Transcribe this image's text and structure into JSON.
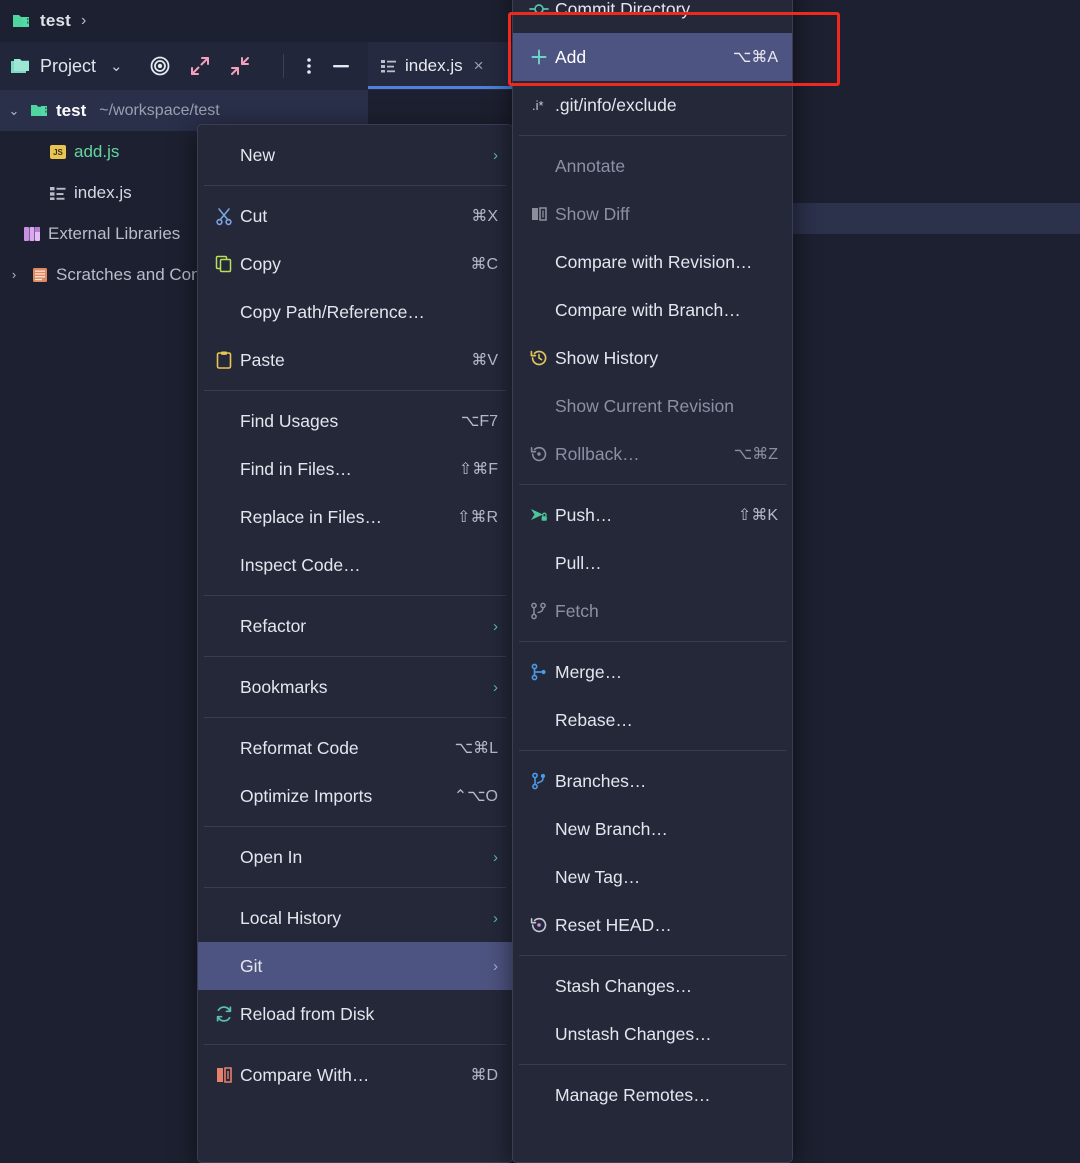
{
  "app": {
    "theme_bg": "#1d2030",
    "menu_bg": "#242839",
    "highlight_color": "#4e5481",
    "annotation_color": "#ee2a1e",
    "accent_blue": "#4d82d8"
  },
  "breadcrumb": {
    "project": "test",
    "separator": "›",
    "icon": "project-folder-icon"
  },
  "tool_window": {
    "title": "Project",
    "chevron": "⌄",
    "icons": [
      {
        "name": "select-opened-file-icon",
        "title": "Select Opened File"
      },
      {
        "name": "expand-all-icon",
        "title": "Expand All"
      },
      {
        "name": "collapse-all-icon",
        "title": "Collapse All"
      },
      {
        "name": "more-options-icon",
        "title": "Options"
      },
      {
        "name": "hide-icon",
        "title": "Hide"
      }
    ]
  },
  "editor_tab": {
    "label": "index.js",
    "icon": "js-file-icon",
    "close": "×"
  },
  "project_tree": [
    {
      "label": "test",
      "path": "~/workspace/test",
      "arrow": "⌄",
      "icon": "module-folder-icon",
      "color": "#ffffff",
      "bold": true,
      "selected": true,
      "indent": 0
    },
    {
      "label": "add.js",
      "path": "",
      "arrow": "",
      "icon": "js-badge-icon",
      "color": "#63d6a0",
      "bold": false,
      "selected": false,
      "indent": 1
    },
    {
      "label": "index.js",
      "path": "",
      "arrow": "",
      "icon": "js-plain-icon",
      "color": "#d6d9e3",
      "bold": false,
      "selected": false,
      "indent": 1
    },
    {
      "label": "External Libraries",
      "path": "",
      "arrow": "",
      "icon": "library-icon",
      "color": "#b9bdca",
      "bold": false,
      "selected": false,
      "indent": 0
    },
    {
      "label": "Scratches and Consoles",
      "path": "",
      "arrow": "›",
      "icon": "scratches-icon",
      "color": "#b9bdca",
      "bold": false,
      "selected": false,
      "indent": 0
    }
  ],
  "context_menu": {
    "items": [
      {
        "type": "item",
        "label": "New",
        "accel": "",
        "arrow": "›",
        "icon": "",
        "disabled": false,
        "highlighted": false
      },
      {
        "type": "separator"
      },
      {
        "type": "item",
        "label": "Cut",
        "accel": "⌘X",
        "arrow": "",
        "icon": "cut-icon",
        "disabled": false,
        "highlighted": false
      },
      {
        "type": "item",
        "label": "Copy",
        "accel": "⌘C",
        "arrow": "",
        "icon": "copy-icon",
        "disabled": false,
        "highlighted": false
      },
      {
        "type": "item",
        "label": "Copy Path/Reference…",
        "accel": "",
        "arrow": "",
        "icon": "",
        "disabled": false,
        "highlighted": false
      },
      {
        "type": "item",
        "label": "Paste",
        "accel": "⌘V",
        "arrow": "",
        "icon": "paste-icon",
        "disabled": false,
        "highlighted": false
      },
      {
        "type": "separator"
      },
      {
        "type": "item",
        "label": "Find Usages",
        "accel": "⌥F7",
        "arrow": "",
        "icon": "",
        "disabled": false,
        "highlighted": false
      },
      {
        "type": "item",
        "label": "Find in Files…",
        "accel": "⇧⌘F",
        "arrow": "",
        "icon": "",
        "disabled": false,
        "highlighted": false
      },
      {
        "type": "item",
        "label": "Replace in Files…",
        "accel": "⇧⌘R",
        "arrow": "",
        "icon": "",
        "disabled": false,
        "highlighted": false
      },
      {
        "type": "item",
        "label": "Inspect Code…",
        "accel": "",
        "arrow": "",
        "icon": "",
        "disabled": false,
        "highlighted": false
      },
      {
        "type": "separator"
      },
      {
        "type": "item",
        "label": "Refactor",
        "accel": "",
        "arrow": "›",
        "icon": "",
        "disabled": false,
        "highlighted": false
      },
      {
        "type": "separator"
      },
      {
        "type": "item",
        "label": "Bookmarks",
        "accel": "",
        "arrow": "›",
        "icon": "",
        "disabled": false,
        "highlighted": false
      },
      {
        "type": "separator"
      },
      {
        "type": "item",
        "label": "Reformat Code",
        "accel": "⌥⌘L",
        "arrow": "",
        "icon": "",
        "disabled": false,
        "highlighted": false
      },
      {
        "type": "item",
        "label": "Optimize Imports",
        "accel": "⌃⌥O",
        "arrow": "",
        "icon": "",
        "disabled": false,
        "highlighted": false
      },
      {
        "type": "separator"
      },
      {
        "type": "item",
        "label": "Open In",
        "accel": "",
        "arrow": "›",
        "icon": "",
        "disabled": false,
        "highlighted": false
      },
      {
        "type": "separator"
      },
      {
        "type": "item",
        "label": "Local History",
        "accel": "",
        "arrow": "›",
        "icon": "",
        "disabled": false,
        "highlighted": false
      },
      {
        "type": "item",
        "label": "Git",
        "accel": "",
        "arrow": "›",
        "icon": "",
        "disabled": false,
        "highlighted": true
      },
      {
        "type": "item",
        "label": "Reload from Disk",
        "accel": "",
        "arrow": "",
        "icon": "reload-icon",
        "disabled": false,
        "highlighted": false
      },
      {
        "type": "separator"
      },
      {
        "type": "item",
        "label": "Compare With…",
        "accel": "⌘D",
        "arrow": "",
        "icon": "compare-icon",
        "disabled": false,
        "highlighted": false
      }
    ]
  },
  "git_submenu": {
    "items": [
      {
        "type": "item",
        "label": "Commit Directory…",
        "accel": "",
        "arrow": "",
        "icon": "commit-icon",
        "disabled": false,
        "highlighted": false
      },
      {
        "type": "item",
        "label": "Add",
        "accel": "⌥⌘A",
        "arrow": "",
        "icon": "add-icon",
        "disabled": false,
        "highlighted": true
      },
      {
        "type": "item",
        "label": ".git/info/exclude",
        "accel": "",
        "arrow": "",
        "icon": "ignore-icon",
        "disabled": false,
        "highlighted": false
      },
      {
        "type": "separator"
      },
      {
        "type": "item",
        "label": "Annotate",
        "accel": "",
        "arrow": "",
        "icon": "",
        "disabled": true,
        "highlighted": false
      },
      {
        "type": "item",
        "label": "Show Diff",
        "accel": "",
        "arrow": "",
        "icon": "diff-icon-disabled",
        "disabled": true,
        "highlighted": false
      },
      {
        "type": "item",
        "label": "Compare with Revision…",
        "accel": "",
        "arrow": "",
        "icon": "",
        "disabled": false,
        "highlighted": false
      },
      {
        "type": "item",
        "label": "Compare with Branch…",
        "accel": "",
        "arrow": "",
        "icon": "",
        "disabled": false,
        "highlighted": false
      },
      {
        "type": "item",
        "label": "Show History",
        "accel": "",
        "arrow": "",
        "icon": "history-icon",
        "disabled": false,
        "highlighted": false
      },
      {
        "type": "item",
        "label": "Show Current Revision",
        "accel": "",
        "arrow": "",
        "icon": "",
        "disabled": true,
        "highlighted": false
      },
      {
        "type": "item",
        "label": "Rollback…",
        "accel": "⌥⌘Z",
        "arrow": "",
        "icon": "rollback-icon",
        "disabled": true,
        "highlighted": false
      },
      {
        "type": "separator"
      },
      {
        "type": "item",
        "label": "Push…",
        "accel": "⇧⌘K",
        "arrow": "",
        "icon": "push-icon",
        "disabled": false,
        "highlighted": false
      },
      {
        "type": "item",
        "label": "Pull…",
        "accel": "",
        "arrow": "",
        "icon": "",
        "disabled": false,
        "highlighted": false
      },
      {
        "type": "item",
        "label": "Fetch",
        "accel": "",
        "arrow": "",
        "icon": "fetch-icon-disabled",
        "disabled": true,
        "highlighted": false
      },
      {
        "type": "separator"
      },
      {
        "type": "item",
        "label": "Merge…",
        "accel": "",
        "arrow": "",
        "icon": "merge-icon",
        "disabled": false,
        "highlighted": false
      },
      {
        "type": "item",
        "label": "Rebase…",
        "accel": "",
        "arrow": "",
        "icon": "",
        "disabled": false,
        "highlighted": false
      },
      {
        "type": "separator"
      },
      {
        "type": "item",
        "label": "Branches…",
        "accel": "",
        "arrow": "",
        "icon": "branches-icon",
        "disabled": false,
        "highlighted": false
      },
      {
        "type": "item",
        "label": "New Branch…",
        "accel": "",
        "arrow": "",
        "icon": "",
        "disabled": false,
        "highlighted": false
      },
      {
        "type": "item",
        "label": "New Tag…",
        "accel": "",
        "arrow": "",
        "icon": "",
        "disabled": false,
        "highlighted": false
      },
      {
        "type": "item",
        "label": "Reset HEAD…",
        "accel": "",
        "arrow": "",
        "icon": "reset-head-icon",
        "disabled": false,
        "highlighted": false
      },
      {
        "type": "separator"
      },
      {
        "type": "item",
        "label": "Stash Changes…",
        "accel": "",
        "arrow": "",
        "icon": "",
        "disabled": false,
        "highlighted": false
      },
      {
        "type": "item",
        "label": "Unstash Changes…",
        "accel": "",
        "arrow": "",
        "icon": "",
        "disabled": false,
        "highlighted": false
      },
      {
        "type": "separator"
      },
      {
        "type": "item",
        "label": "Manage Remotes…",
        "accel": "",
        "arrow": "",
        "icon": "",
        "disabled": false,
        "highlighted": false
      }
    ]
  },
  "annotation": {
    "target": "Add",
    "shape": "rectangle",
    "color": "#ee2a1e"
  }
}
